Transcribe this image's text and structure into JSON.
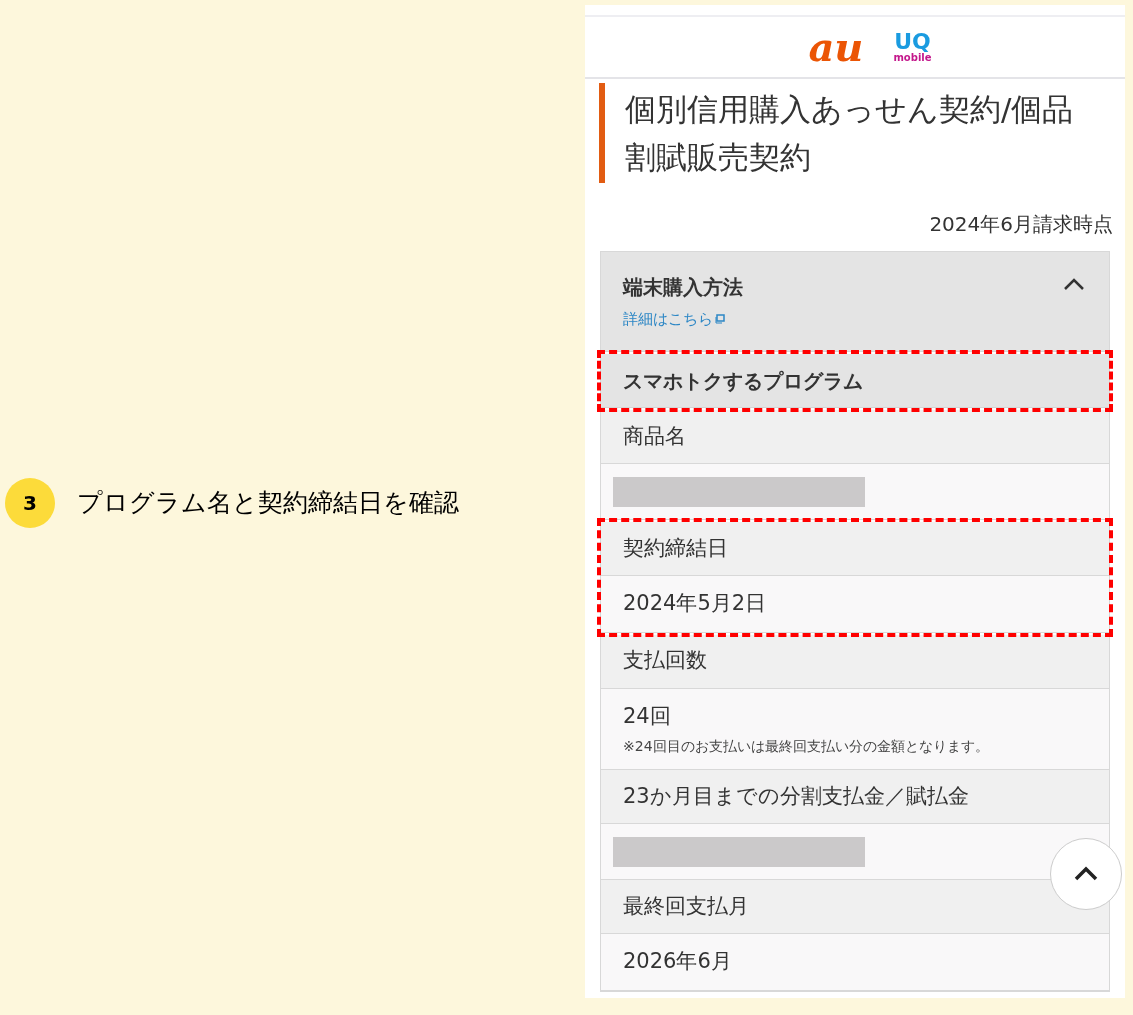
{
  "step": {
    "number": "3",
    "caption": "プログラム名と契約締結日を確認"
  },
  "header": {
    "logos": [
      {
        "kind": "au",
        "text": "au"
      },
      {
        "kind": "uq",
        "text": "UQ",
        "subtext": "mobile"
      }
    ]
  },
  "page_title": "個別信用購入あっせん契約/個品割賦販売契約",
  "as_of": "2024年6月請求時点",
  "section": {
    "title": "端末購入方法",
    "link": "詳細はこちら",
    "expanded": true
  },
  "groups": [
    {
      "highlighted": true,
      "rows": [
        {
          "kind": "heading",
          "text": "スマホトクするプログラム"
        }
      ]
    },
    {
      "highlighted": false,
      "rows": [
        {
          "kind": "label",
          "text": "商品名"
        },
        {
          "kind": "redacted"
        }
      ]
    },
    {
      "highlighted": true,
      "rows": [
        {
          "kind": "label",
          "text": "契約締結日"
        },
        {
          "kind": "value",
          "text": "2024年5月2日"
        }
      ]
    },
    {
      "highlighted": false,
      "rows": [
        {
          "kind": "label",
          "text": "支払回数"
        },
        {
          "kind": "value",
          "text": "24回",
          "note": "※24回目のお支払いは最終回支払い分の金額となります。"
        },
        {
          "kind": "label",
          "text": "23か月目までの分割支払金／賦払金"
        },
        {
          "kind": "redacted"
        },
        {
          "kind": "label",
          "text": "最終回支払月"
        },
        {
          "kind": "value",
          "text": "2026年6月"
        }
      ]
    }
  ]
}
